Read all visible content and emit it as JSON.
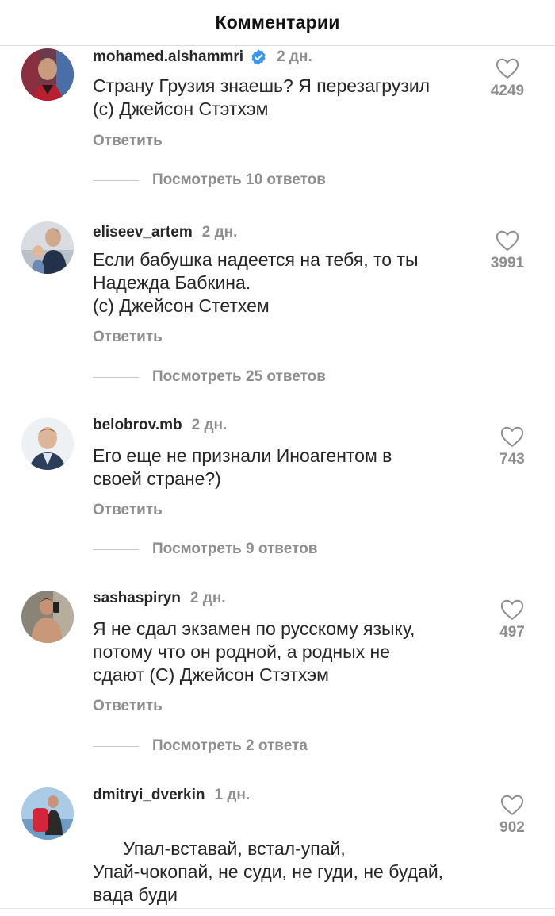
{
  "header": {
    "title": "Комментарии"
  },
  "colors": {
    "verified": "#3897f0",
    "muted": "#8e8e8e",
    "heart_emoji": "#e0245e"
  },
  "comments": [
    {
      "username": "mohamed.alshammri",
      "verified": true,
      "time": "2 дн.",
      "text": "Страну Грузия знаешь? Я перезагрузил\n(с) Джейсон Стэтхэм",
      "reply_label": "Ответить",
      "view_replies": "Посмотреть 10 ответов",
      "likes": "4249"
    },
    {
      "username": "eliseev_artem",
      "verified": false,
      "time": "2 дн.",
      "text": "Если бабушка надеется на тебя, то ты\nНадежда Бабкина.\n(с) Джейсон Стетхем",
      "reply_label": "Ответить",
      "view_replies": "Посмотреть 25 ответов",
      "likes": "3991"
    },
    {
      "username": "belobrov.mb",
      "verified": false,
      "time": "2 дн.",
      "text": "Его еще не признали Иноагентом в\nсвоей стране?)",
      "reply_label": "Ответить",
      "view_replies": "Посмотреть 9 ответов",
      "likes": "743"
    },
    {
      "username": "sashaspiryn",
      "verified": false,
      "time": "2 дн.",
      "text": "Я не сдал экзамен по русскому языку,\nпотому что он родной, а родных не\nсдают (С) Джейсон Стэтхэм",
      "reply_label": "Ответить",
      "view_replies": "Посмотреть 2 ответа",
      "likes": "497"
    },
    {
      "username": "dmitryi_dverkin",
      "verified": false,
      "time": "1 дн.",
      "text": "Упал-вставай, встал-упай,\nУпай-чокопай, не суди, не гуди, не будай,\nвада буди\n дабуди дабудай ",
      "emoji": "heart-emoji",
      "likes": "902"
    }
  ]
}
